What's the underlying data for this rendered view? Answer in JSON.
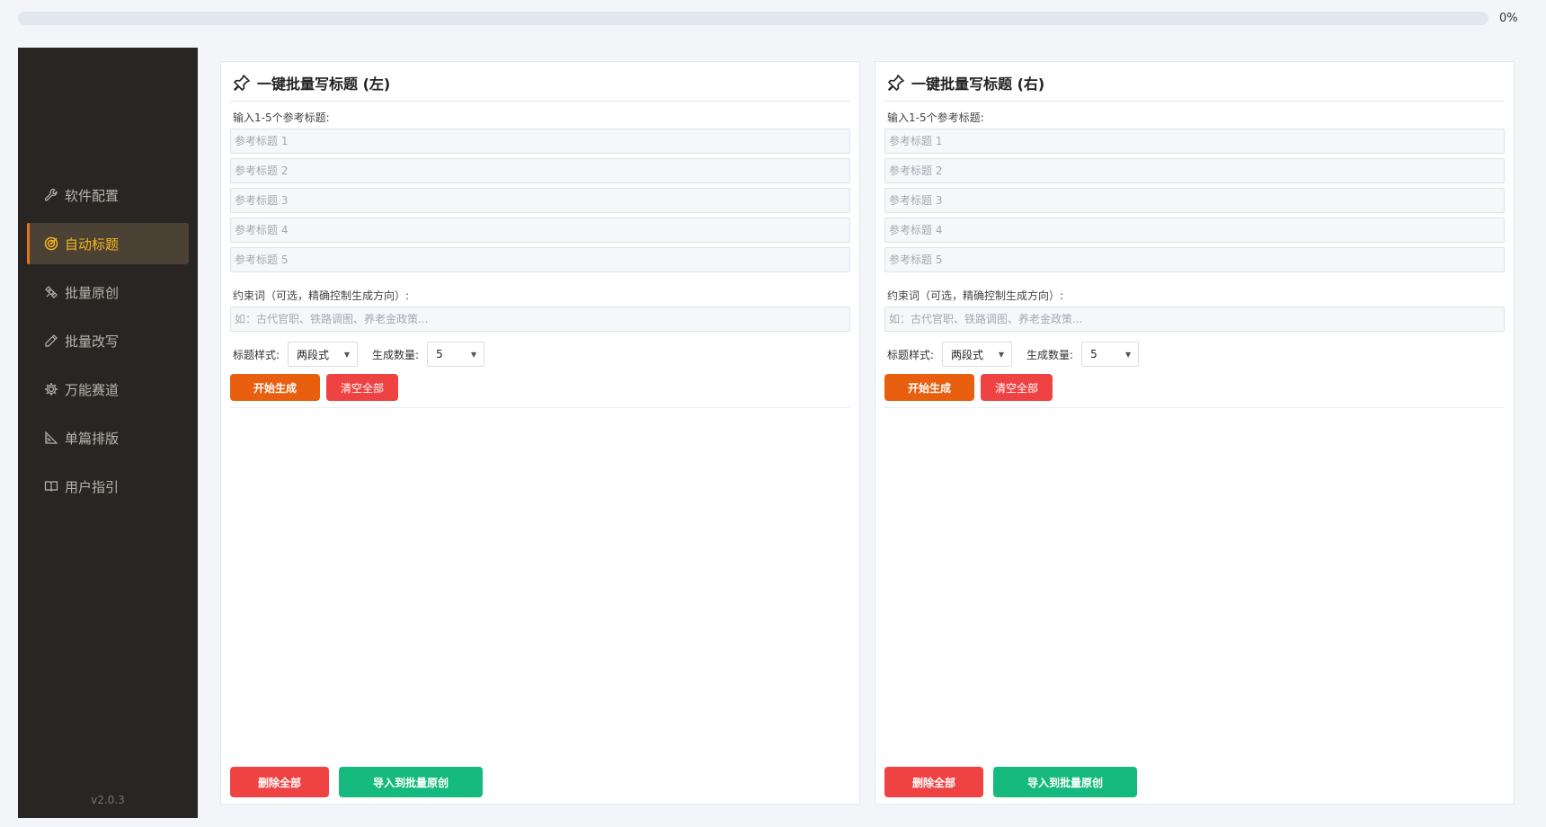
{
  "progress": {
    "percent_text": "0%",
    "value": 0
  },
  "sidebar": {
    "items": [
      {
        "label": "软件配置",
        "icon": "wrench-icon",
        "active": false
      },
      {
        "label": "自动标题",
        "icon": "target-icon",
        "active": true
      },
      {
        "label": "批量原创",
        "icon": "satellite-icon",
        "active": false
      },
      {
        "label": "批量改写",
        "icon": "pencil-icon",
        "active": false
      },
      {
        "label": "万能赛道",
        "icon": "gear-icon",
        "active": false
      },
      {
        "label": "单篇排版",
        "icon": "ruler-triangle-icon",
        "active": false
      },
      {
        "label": "用户指引",
        "icon": "book-icon",
        "active": false
      }
    ],
    "version": "v2.0.3"
  },
  "panels": {
    "left": {
      "title": "一键批量写标题 (左)",
      "ref_label": "输入1-5个参考标题:",
      "refs": [
        "参考标题 1",
        "参考标题 2",
        "参考标题 3",
        "参考标题 4",
        "参考标题 5"
      ],
      "constraint_label": "约束词（可选，精确控制生成方向）:",
      "constraint_placeholder": "如：古代官职、铁路调图、养老金政策...",
      "style_label": "标题样式:",
      "style_value": "两段式",
      "count_label": "生成数量:",
      "count_value": "5",
      "start_label": "开始生成",
      "clear_label": "清空全部",
      "delete_label": "删除全部",
      "import_label": "导入到批量原创"
    },
    "right": {
      "title": "一键批量写标题 (右)",
      "ref_label": "输入1-5个参考标题:",
      "refs": [
        "参考标题 1",
        "参考标题 2",
        "参考标题 3",
        "参考标题 4",
        "参考标题 5"
      ],
      "constraint_label": "约束词（可选，精确控制生成方向）:",
      "constraint_placeholder": "如：古代官职、铁路调图、养老金政策...",
      "style_label": "标题样式:",
      "style_value": "两段式",
      "count_label": "生成数量:",
      "count_value": "5",
      "start_label": "开始生成",
      "clear_label": "清空全部",
      "delete_label": "删除全部",
      "import_label": "导入到批量原创"
    }
  },
  "colors": {
    "accent": "#e8600f",
    "sidebar_bg": "#292522",
    "active_text": "#f5b71f",
    "danger": "#ef4343",
    "success": "#16b97e"
  }
}
